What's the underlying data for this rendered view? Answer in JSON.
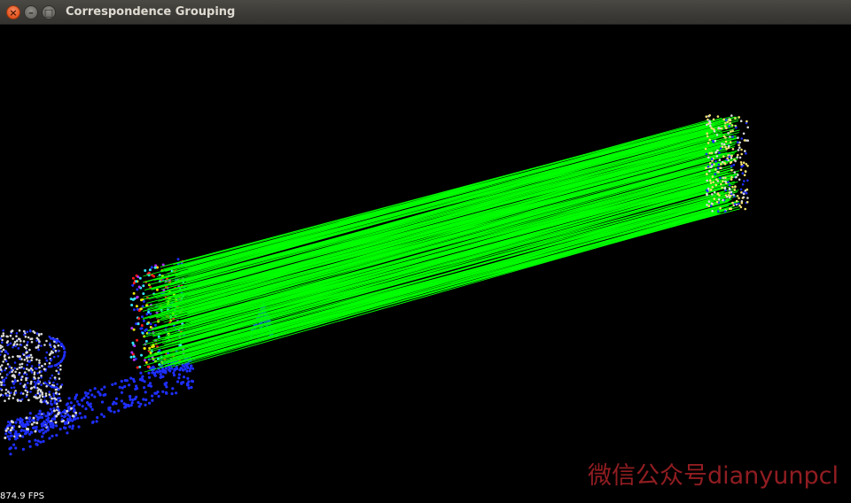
{
  "window": {
    "title": "Correspondence Grouping",
    "buttons": {
      "close_glyph": "×",
      "minimize_glyph": "–",
      "maximize_glyph": "□"
    }
  },
  "viewer": {
    "background_color": "#000000",
    "fps_text": "874.9 FPS",
    "colors": {
      "correspondence_line": "#00ff00",
      "scene_points": "#1f2fff",
      "model_points": "#d8d8d8",
      "keypoints_red": "#ff1a1a",
      "keypoints_yellow": "#e6e600",
      "keypoints_cyan": "#33e6ff",
      "model_keypoints": "#f0e070"
    }
  },
  "watermark": {
    "text": "微信公众号dianyunpcl",
    "color": "#c1272d"
  }
}
